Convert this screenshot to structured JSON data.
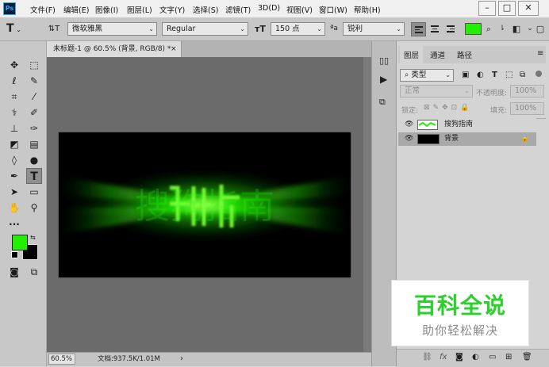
{
  "menu": {
    "logo": "Ps",
    "items": [
      "文件(F)",
      "编辑(E)",
      "图像(I)",
      "图层(L)",
      "文字(Y)",
      "选择(S)",
      "滤镜(T)",
      "3D(D)",
      "视图(V)",
      "窗口(W)",
      "帮助(H)"
    ]
  },
  "options": {
    "font_family": "微软雅黑",
    "font_style": "Regular",
    "font_size": "150 点",
    "aa_label": "ªa",
    "antialias": "锐利",
    "text_color": "#22ee00"
  },
  "document": {
    "tab_title": "未标题-1 @ 60.5% (背景, RGB/8) *",
    "close": "×",
    "zoom": "60.5%",
    "doc_info": "文档:937.5K/1.01M",
    "canvas_text": "搜狗指南",
    "glow_color": "#1cff00"
  },
  "colors": {
    "foreground": "#22ee00",
    "background": "#000000"
  },
  "layers_panel": {
    "tabs": [
      "图层",
      "通道",
      "路径"
    ],
    "filter": "类型",
    "blend_mode": "正常",
    "opacity_label": "不透明度:",
    "opacity_value": "100%",
    "lock_label": "锁定:",
    "fill_label": "填充:",
    "fill_value": "100%",
    "layers": [
      {
        "name": "搜狗指南",
        "kind": "text"
      },
      {
        "name": "背景",
        "kind": "background"
      }
    ]
  },
  "watermark": {
    "title": "百科全说",
    "subtitle": "助你轻松解决"
  }
}
